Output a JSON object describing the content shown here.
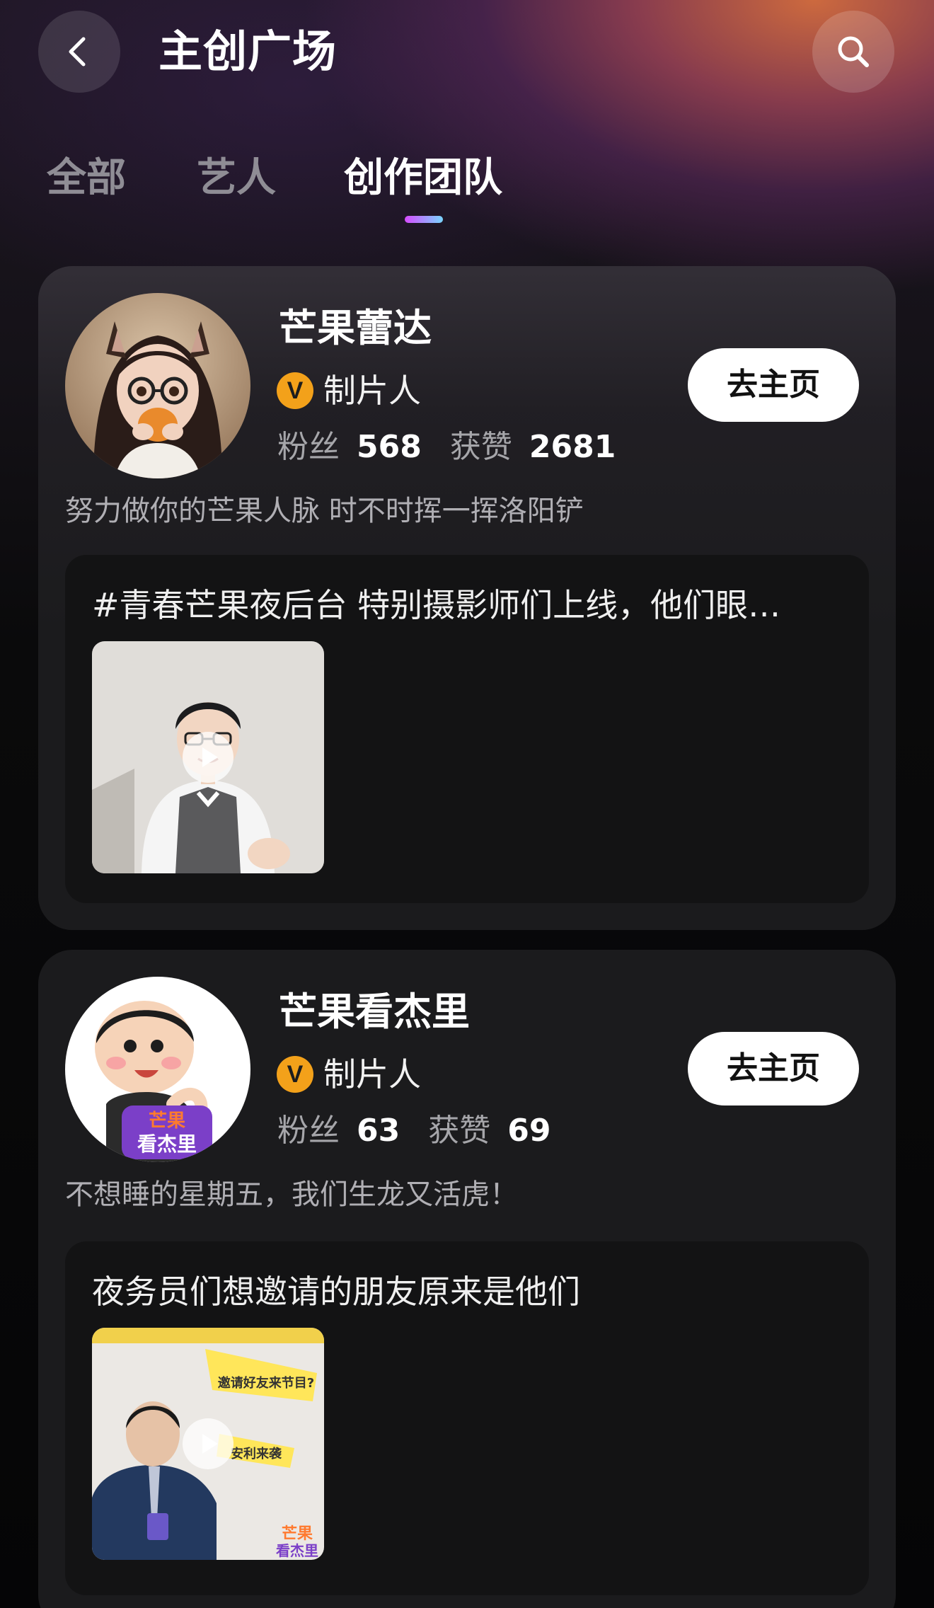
{
  "header": {
    "title": "主创广场",
    "back_icon": "chevron-left-icon",
    "search_icon": "search-icon"
  },
  "tabs": [
    {
      "label": "全部",
      "active": false
    },
    {
      "label": "艺人",
      "active": false
    },
    {
      "label": "创作团队",
      "active": true
    }
  ],
  "creators": [
    {
      "name": "芒果蕾达",
      "badge": "V",
      "role": "制片人",
      "fans_label": "粉丝",
      "fans": "568",
      "likes_label": "获赞",
      "likes": "2681",
      "button_label": "去主页",
      "bio": "努力做你的芒果人脉 时不时挥一挥洛阳铲",
      "post": {
        "title": "#青春芒果夜后台 特别摄影师们上线，他们眼…"
      }
    },
    {
      "name": "芒果看杰里",
      "badge": "V",
      "role": "制片人",
      "fans_label": "粉丝",
      "fans": "63",
      "likes_label": "获赞",
      "likes": "69",
      "button_label": "去主页",
      "bio": "不想睡的星期五，我们生龙又活虎！",
      "avatar_text_top": "芒果",
      "avatar_text_bottom": "看杰里",
      "post": {
        "title": "夜务员们想邀请的朋友原来是他们",
        "thumb_text_1": "邀请好友来节目?",
        "thumb_text_2": "安利来袭",
        "thumb_logo_top": "芒果",
        "thumb_logo_bottom": "看杰里"
      }
    }
  ],
  "colors": {
    "accent_orange": "#f3a11a",
    "tab_indicator_start": "#d64cff",
    "tab_indicator_end": "#79d5ff",
    "card_bg": "#1b1b1d"
  }
}
